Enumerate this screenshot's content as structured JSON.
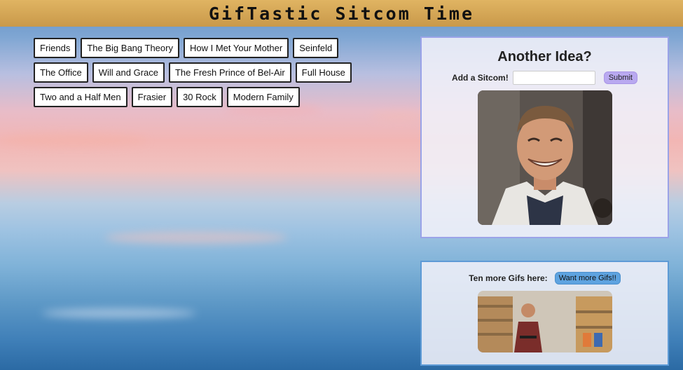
{
  "header": {
    "title": "GifTastic Sitcom Time"
  },
  "sitcoms": [
    "Friends",
    "The Big Bang Theory",
    "How I Met Your Mother",
    "Seinfeld",
    "The Office",
    "Will and Grace",
    "The Fresh Prince of Bel-Air",
    "Full House",
    "Two and a Half Men",
    "Frasier",
    "30 Rock",
    "Modern Family"
  ],
  "add_panel": {
    "title": "Another Idea?",
    "label": "Add a Sitcom!",
    "input_value": "",
    "submit_label": "Submit"
  },
  "more_panel": {
    "label": "Ten more Gifs here:",
    "button_label": "Want more Gifs!!"
  },
  "colors": {
    "header": "#d4a656",
    "submit": "#b9a9f0",
    "more_button": "#5ea3e0",
    "top_panel_border": "#9aa3e8",
    "bottom_panel_border": "#5e9bd6"
  }
}
